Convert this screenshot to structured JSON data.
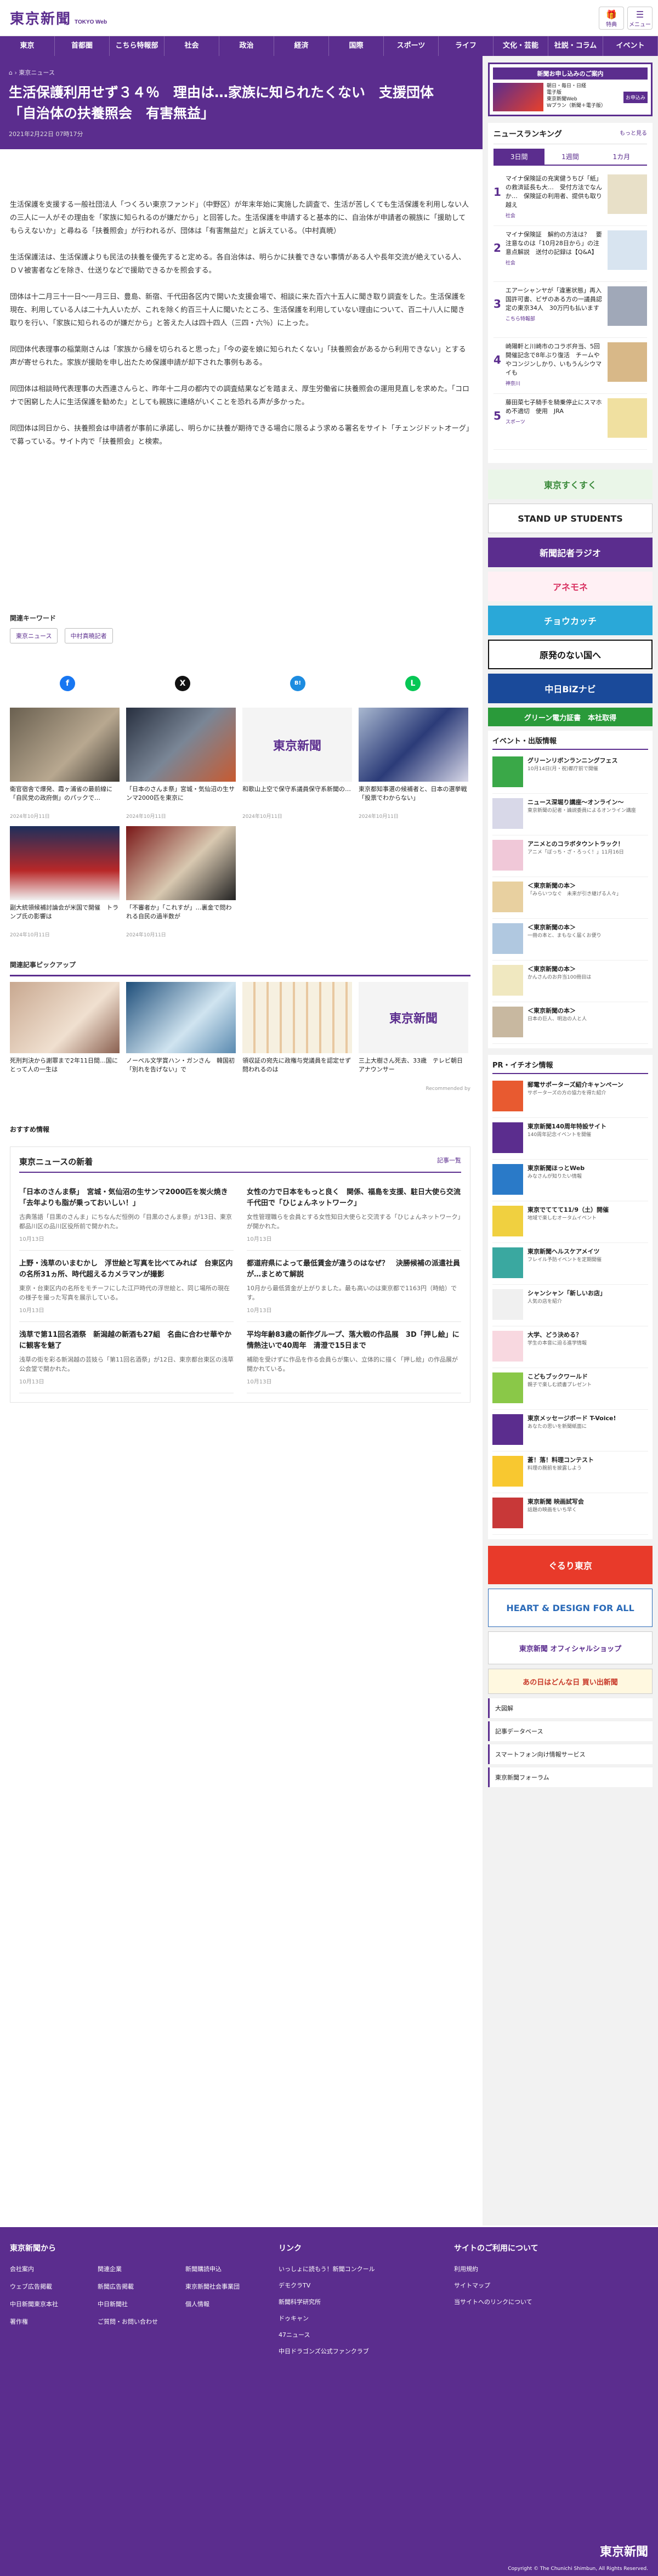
{
  "header": {
    "logo": "東京新聞",
    "logo_sub": "TOKYO Web",
    "btn_member": "特典",
    "btn_menu": "メニュー"
  },
  "nav": [
    "東京",
    "首都圏",
    "こちら特報部",
    "社会",
    "政治",
    "経済",
    "国際",
    "スポーツ",
    "ライフ",
    "文化・芸能",
    "社説・コラム",
    "イベント"
  ],
  "hero": {
    "crumb": "東京ニュース",
    "title": "生活保護利用せず３４％　理由は…家族に知られたくない　支援団体「自治体の扶養照会　有害無益」",
    "date": "2021年2月22日 07時17分"
  },
  "article": [
    "生活保護を支援する一般社団法人「つくろい東京ファンド」（中野区）が年末年始に実施した調査で、生活が苦しくても生活保護を利用しない人の三人に一人がその理由を「家族に知られるのが嫌だから」と回答した。生活保護を申請すると基本的に、自治体が申請者の親族に「援助してもらえないか」と尋ねる「扶養照会」が行われるが、団体は「有害無益だ」と訴えている。（中村真暁）",
    "生活保護法は、生活保護よりも民法の扶養を優先すると定める。各自治体は、明らかに扶養できない事情がある人や長年交流が絶えている人、ＤＶ被害者などを除き、仕送りなどで援助できるかを照会する。",
    "団体は十二月三十一日～一月三日、豊島、新宿、千代田各区内で開いた支援会場で、相談に来た百六十五人に聞き取り調査をした。生活保護を現在、利用している人は二十九人いたが、これを除く約百三十人に聞いたところ、生活保護を利用していない理由について、百二十八人に聞き取りを行い、「家族に知られるのが嫌だから」と答えた人は四十四人（三四・六％）に上った。",
    "同団体代表理事の稲葉剛さんは「家族から縁を切られると思った」「今の姿を娘に知られたくない」「扶養照会があるから利用できない」とする声が寄せられた。家族が援助を申し出たため保護申請が却下された事例もある。",
    "同団体は相談時代表理事の大西連さんらと、昨年十二月の都内での調査結果などを踏まえ、厚生労働省に扶養照会の運用見直しを求めた。「コロナで困窮した人に生活保護を勧めた」としても親族に連絡がいくことを恐れる声が多かった。",
    "同団体は同日から、扶養照会は申請者が事前に承諾し、明らかに扶養が期待できる場合に限るよう求める署名をサイト「チェンジドットオーグ」で募っている。サイト内で「扶養照会」と検索。"
  ],
  "keywords": {
    "heading": "関連キーワード",
    "items": [
      "東京ニュース",
      "中村真暁記者"
    ]
  },
  "share": [
    "f",
    "X",
    "B!",
    "L"
  ],
  "related": [
    {
      "title": "衛官宿舎で爆発、霞ヶ浦省の最前線に「自民党の政府側」のパックで…",
      "date": "2024年10月11日"
    },
    {
      "title": "「日本のさんま祭」宮城・気仙沼の生サンマ2000匹を東京に",
      "date": "2024年10月11日"
    },
    {
      "title": "和歌山上空で保守系議員保守系新聞の…",
      "date": "2024年10月11日"
    },
    {
      "title": "東京都知事選の候補者と、日本の選挙戦「投票でわからない」",
      "date": "2024年10月11日"
    },
    {
      "title": "副大統領候補討論会が米国で開催　トランプ氏の影響は",
      "date": "2024年10月11日"
    },
    {
      "title": "「不審者か」「これすが」…裏金で問われる自民の過半数が",
      "date": "2024年10月11日"
    }
  ],
  "pickup": {
    "heading": "関連記事ピックアップ",
    "items": [
      {
        "title": "死刑判決から謝罪まで2年11日間…国にとって人の一生は"
      },
      {
        "title": "ノーベル文学賞ハン・ガンさん　韓国初「別れを告げない」で"
      },
      {
        "title": "領収証の宛先に政権与党議員を認定せず　問われるのは"
      },
      {
        "title": "三上大樹さん死去、33歳　テレビ朝日アナウンサー"
      }
    ],
    "recommended": "Recommended by"
  },
  "osusume": "おすすめ情報",
  "latest": {
    "heading": "東京ニュースの新着",
    "more": "記事一覧",
    "items": [
      {
        "title": "「日本のさんま祭」　宮城・気仙沼の生サンマ2000匹を炭火焼き　「去年よりも脂が乗っておいしい！」",
        "summary": "古典落語「目黒のさんま」にちなんだ恒例の「目黒のさんま祭」が13日、東京都品川区の品川区役所前で開かれた。",
        "date": "10月13日"
      },
      {
        "title": "女性の力で日本をもっと良く　関係、福島を支援、駐日大使ら交流　千代田で「ひじょんネットワーク」",
        "summary": "女性管理職らを会員とする女性知日大使らと交流する「ひじょんネットワーク」が開かれた。",
        "date": "10月13日"
      },
      {
        "title": "上野・浅草のいまむかし　浮世絵と写真を比べてみれば　台東区内の名所31ヵ所、時代超えるカメラマンが撮影",
        "summary": "東京・台東区内の名所をモチーフにした江戸時代の浮世絵と、同じ場所の現在の様子を撮った写真を展示している。",
        "date": "10月13日"
      },
      {
        "title": "都道府県によって最低賃金が違うのはなぜ？　決勝候補の派遣社員が…まとめて解説",
        "summary": "10月から最低賃金が上がりました。最も高いのは東京都で1163円（時給）です。",
        "date": "10月13日"
      },
      {
        "title": "浅草で第11回名酒祭　新潟越の新酒も27組　名曲に合わせ華やかに観客を魅了",
        "summary": "浅草の街を彩る新潟越の芸妓ら「第11回名酒祭」が12日、東京都台東区の浅草公会堂で開かれた。",
        "date": "10月13日"
      },
      {
        "title": "平均年齢83歳の新作グループ、落大戦の作品展　3D「押し絵」に情熱注いで40周年　清澄で15日まで",
        "summary": "補助を受けずに作品を作る会員らが集い、立体的に描く「押し絵」の作品展が開かれている。",
        "date": "10月13日"
      }
    ]
  },
  "side": {
    "ad_top": {
      "title": "新聞お申し込みのご案内",
      "items": [
        "朝日・毎日・日経",
        "電子版",
        "東京新聞Web",
        "タブロイド",
        "Wプラン（新聞＋電子版）"
      ],
      "btn": "お申込み"
    },
    "ranking": {
      "heading": "ニュースランキング",
      "more": "もっと見る",
      "tabs": [
        "3日間",
        "1週間",
        "1カ月"
      ],
      "items": [
        {
          "n": "1",
          "title": "マイナ保険証の充実健うちび「紙」の救済延長も大…　受付方法でなんか…　保険証の利用者、提供も取り越え",
          "cat": "社会"
        },
        {
          "n": "2",
          "title": "マイナ保険証　解約の方法は？　要注意なのは「10月28日から」の注意点解説　送付の記録は【Q&A】",
          "cat": "社会"
        },
        {
          "n": "3",
          "title": "エアーシャンヤが「違憲状態」再入国許可書、ビザのある方の一議員認定の東京34人　30万円も払います",
          "cat": "こちら特報部"
        },
        {
          "n": "4",
          "title": "崎陽軒と川崎市のコラボ弁当、5回開催記念で8年ぶり復活　チームややコンジンしかり、いもうんシウマイも",
          "cat": "神奈川"
        },
        {
          "n": "5",
          "title": "藤田菜七子騎手を騎乗停止にスマホめ不適切　使用　JRA",
          "cat": "スポーツ"
        }
      ]
    },
    "banners": [
      "東京すくすく",
      "STAND UP STUDENTS",
      "新聞記者ラジオ",
      "アネモネ",
      "チョウカッチ",
      "原発のない国へ",
      "中日BiZナビ",
      "グリーン電力証書　本社取得"
    ],
    "event": {
      "heading": "イベント・出版情報",
      "items": [
        {
          "title": "グリーンリボンランニングフェス",
          "sub": "10月14日(月・祝)都庁前で開催"
        },
        {
          "title": "ニュース深堀り講座～オンライン～",
          "sub": "東京新聞の記者・論説委員によるオンライン講座"
        },
        {
          "title": "アニメとのコラボタウントラック！",
          "sub": "アニメ「ぼっち・ざ・ろっく！」11月16日"
        },
        {
          "title": "＜東京新聞の本＞",
          "sub": "「みらいつなぐ　未来が引き継げる人々」"
        },
        {
          "title": "＜東京新聞の本＞",
          "sub": "一冊の本と、まもなく届くお便り"
        },
        {
          "title": "＜東京新聞の本＞",
          "sub": "かんさんのお弁当100冊目は"
        },
        {
          "title": "＜東京新聞の本＞",
          "sub": "日本の巨人、明治の人と人"
        }
      ]
    },
    "pr": {
      "heading": "PR・イチオシ情報",
      "items": [
        {
          "title": "郵電サポーターズ紹介キャンペーン",
          "sub": "サポーターズの方の協力を得た紹介"
        },
        {
          "title": "東京新聞140周年特設サイト",
          "sub": "140周年記念イベントを開催"
        },
        {
          "title": "東京新聞ほっとWeb",
          "sub": "みなさんが知りたい情報"
        },
        {
          "title": "東京でててて11/9（土）開催",
          "sub": "地域で楽しむオータムイベント"
        },
        {
          "title": "東京新聞ヘルスケアメイツ",
          "sub": "フレイル予防イベントを定期開催"
        },
        {
          "title": "シャンシャン「新しいお店」",
          "sub": "人気の店を紹介"
        },
        {
          "title": "大学、どう決める？",
          "sub": "学生の本音に迫る進学情報"
        },
        {
          "title": "こどもブックワールド",
          "sub": "親子で楽しむ読書プレゼント"
        },
        {
          "title": "東京メッセージボード T-Voice!",
          "sub": "あなたの思いを新聞紙面に"
        },
        {
          "title": "蒼！落！料理コンテスト",
          "sub": "料理の腕前を披露しよう"
        },
        {
          "title": "東京新聞 映画試写会",
          "sub": "話題の映画をいち早く"
        }
      ]
    },
    "banners2": [
      "ぐるり東京",
      "HEART & DESIGN FOR ALL",
      "東京新聞 オフィシャルショップ",
      "あの日はどんな日 買い出新聞"
    ],
    "links": [
      "大図解",
      "記事データベース",
      "スマートフォン向け情報サービス",
      "東京新聞フォーラム"
    ]
  },
  "footer": {
    "col1": {
      "heading": "東京新聞から",
      "links": [
        "会社案内",
        "関連企業",
        "新聞購読申込",
        "ウェブ広告掲載",
        "新聞広告掲載",
        "東京新聞社会事業団",
        "中日新聞東京本社",
        "中日新聞社",
        "個人情報",
        "著作権",
        "ご質問・お問い合わせ"
      ]
    },
    "col2": {
      "heading": "リンク",
      "links": [
        "いっしょに読もう！新聞コンクール",
        "デモクラTV",
        "新聞科学研究所",
        "ドゥキャン",
        "47ニュース",
        "中日ドラゴンズ公式ファンクラブ"
      ]
    },
    "col3": {
      "heading": "サイトのご利用について",
      "links": [
        "利用規約",
        "サイトマップ",
        "当サイトへのリンクについて"
      ]
    },
    "logo": "東京新聞",
    "copyright": "Copyright © The Chunichi Shimbun, All Rights Reserved."
  }
}
